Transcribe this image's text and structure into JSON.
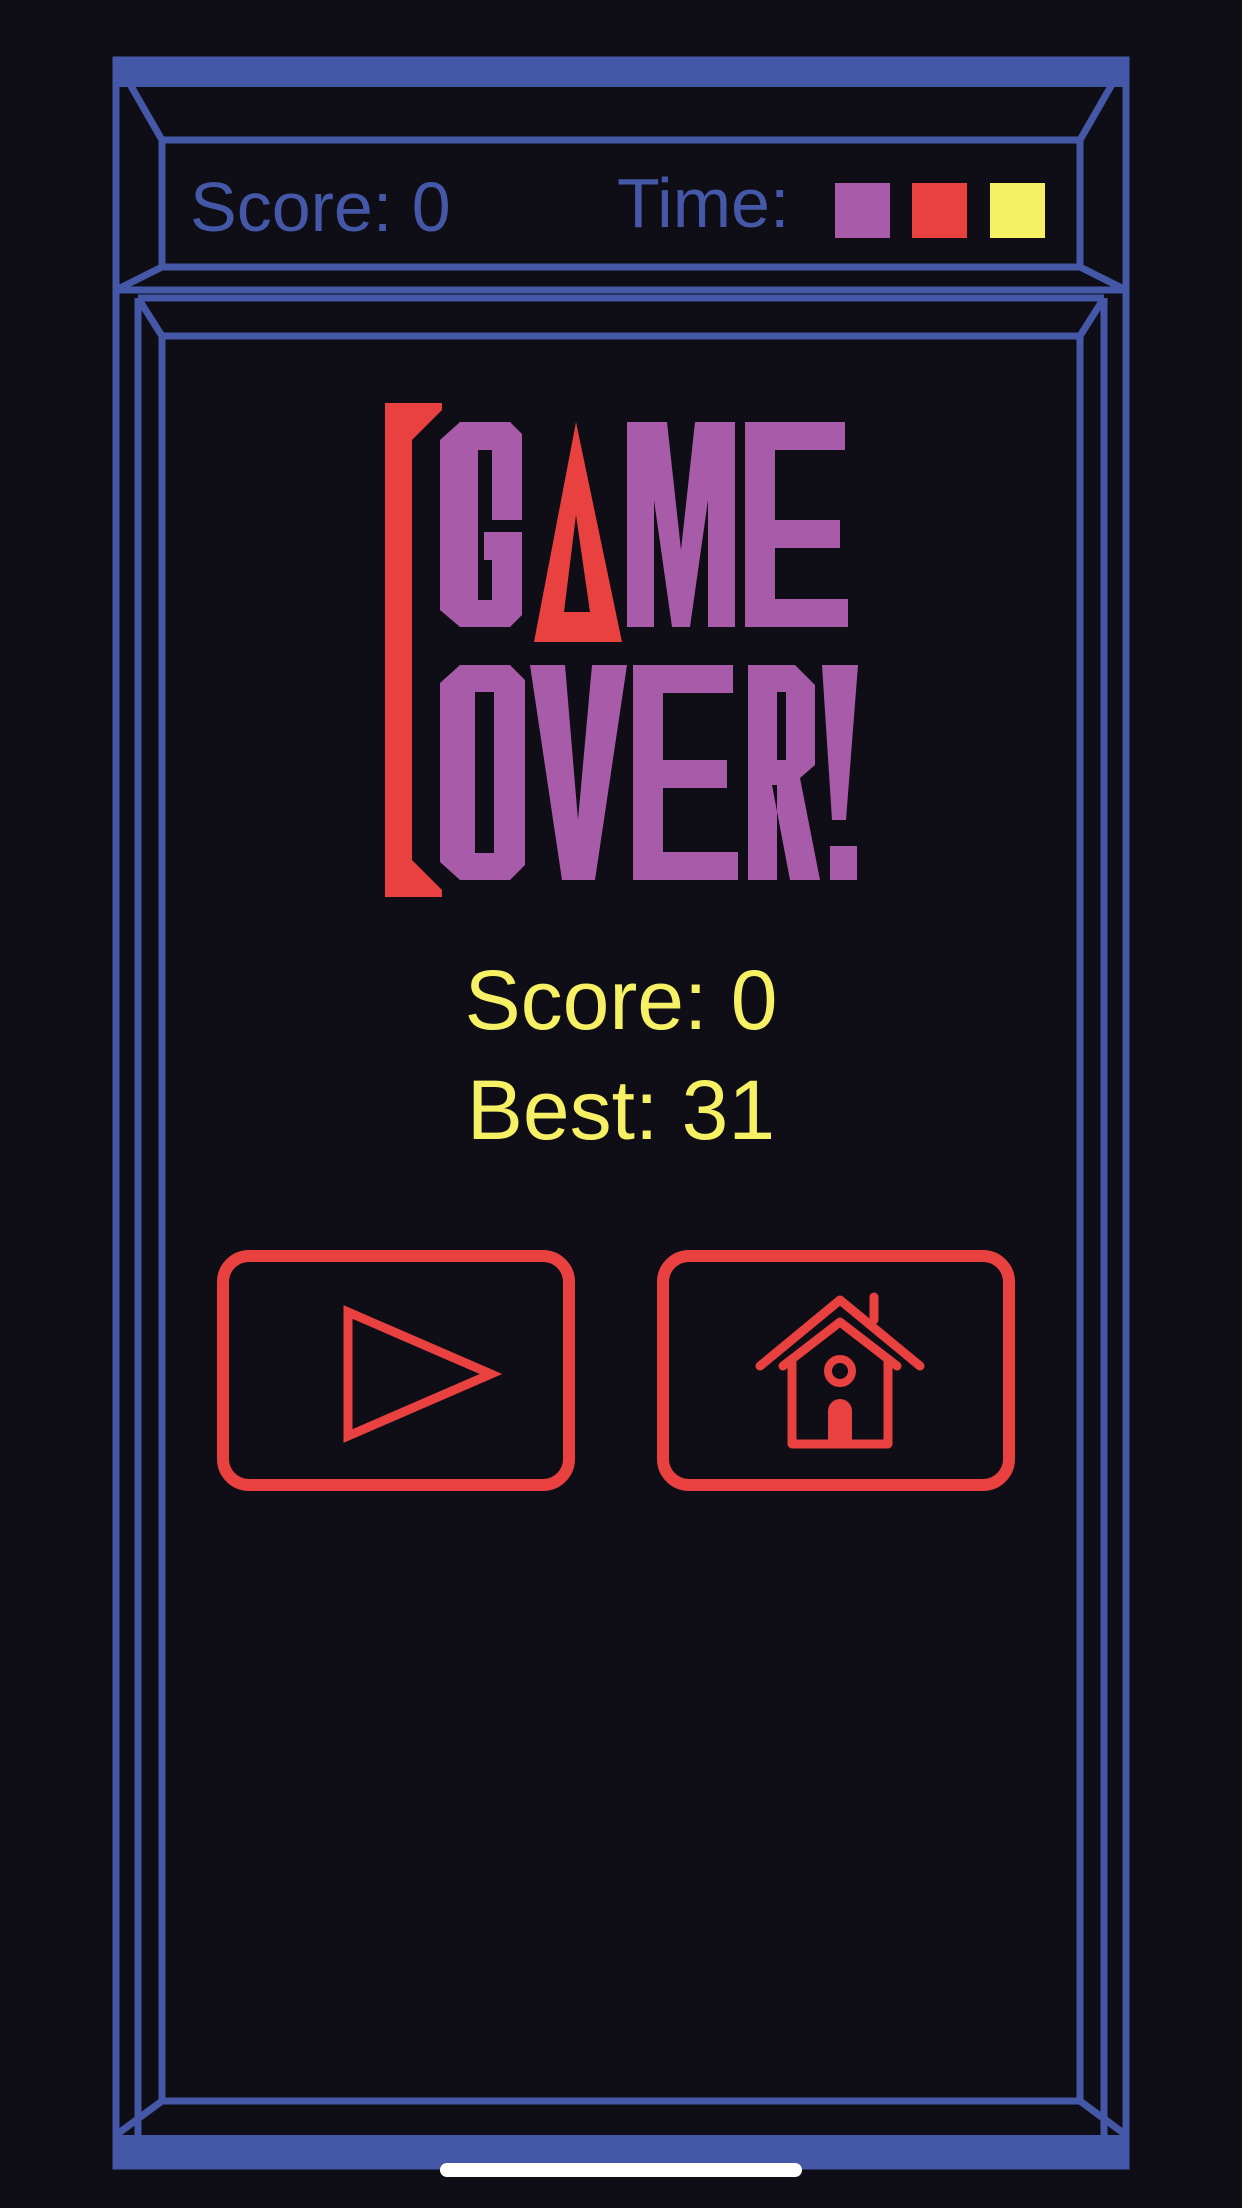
{
  "colors": {
    "background": "#0f0d16",
    "frame": "#4558a8",
    "hud_text": "#4558a8",
    "purple": "#a85ba8",
    "red": "#e8413f",
    "yellow": "#f6f064",
    "home_indicator": "#ffffff"
  },
  "hud": {
    "score_text": "Score: 0",
    "time_label": "Time:",
    "time_squares": [
      {
        "name": "purple",
        "color": "#a85ba8"
      },
      {
        "name": "red",
        "color": "#e8413f"
      },
      {
        "name": "yellow",
        "color": "#f6f064"
      }
    ]
  },
  "title": {
    "line1": "GAME",
    "line2": "OVER!"
  },
  "results": {
    "score_text": "Score: 0",
    "best_text": "Best: 31"
  },
  "buttons": {
    "play_icon": "play-icon",
    "home_icon": "home-icon"
  }
}
